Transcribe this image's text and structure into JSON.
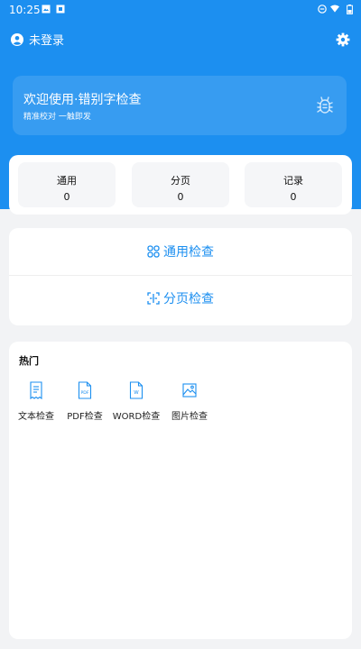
{
  "status_bar": {
    "time": "10:25",
    "icons": [
      "image-icon",
      "image-icon",
      "do-not-disturb-icon",
      "wifi-icon",
      "battery-icon"
    ]
  },
  "header": {
    "user_label": "未登录",
    "icons": [
      "user-icon",
      "gear-icon"
    ]
  },
  "welcome": {
    "title": "欢迎使用·错别字检查",
    "subtitle": "精准校对 一触即发",
    "icon": "bug-icon"
  },
  "stats": [
    {
      "label": "通用",
      "value": "0"
    },
    {
      "label": "分页",
      "value": "0"
    },
    {
      "label": "记录",
      "value": "0"
    }
  ],
  "checks": [
    {
      "label": "通用检查",
      "icon": "grid-icon"
    },
    {
      "label": "分页检查",
      "icon": "split-icon"
    }
  ],
  "hot": {
    "title": "热门",
    "items": [
      {
        "label": "文本检查",
        "icon": "text-doc-icon"
      },
      {
        "label": "PDF检查",
        "icon": "pdf-icon"
      },
      {
        "label": "WORD检查",
        "icon": "word-icon"
      },
      {
        "label": "图片检查",
        "icon": "image-icon"
      }
    ]
  },
  "colors": {
    "brand_blue": "#1c8ff0",
    "background": "#f2f3f5",
    "card": "#ffffff"
  }
}
